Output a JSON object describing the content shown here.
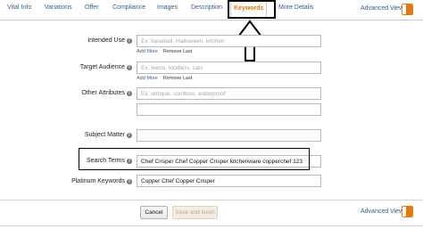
{
  "tabs": [
    {
      "label": "Vital Info"
    },
    {
      "label": "Variations"
    },
    {
      "label": "Offer"
    },
    {
      "label": "Compliance"
    },
    {
      "label": "Images"
    },
    {
      "label": "Description"
    },
    {
      "label": "Keywords",
      "active": true
    },
    {
      "label": "More Details"
    }
  ],
  "advanced_view": {
    "label": "Advanced View",
    "enabled": true
  },
  "accent_color": "#e47911",
  "link_color": "#3a5a8a",
  "form": {
    "intended_use": {
      "label": "Intended Use",
      "placeholder": "Ex: baseball, Halloween, kitchen",
      "add_more": "Add More",
      "remove_last": "Remove Last"
    },
    "target_audience": {
      "label": "Target Audience",
      "placeholder": "Ex: teens, toddlers, cats",
      "add_more": "Add More",
      "remove_last": "Remove Last"
    },
    "other_attributes": {
      "label": "Other Attributes",
      "placeholder": "Ex: antique, cordless, waterproof",
      "value2": ""
    },
    "subject_matter": {
      "label": "Subject Matter",
      "value": ""
    },
    "search_terms": {
      "label": "Search Terms",
      "value": "Chef Crisper Chef Copper Crisper kitchenware copperchef 123"
    },
    "platinum_keywords": {
      "label": "Platinum Keywords",
      "value": "Copper Chef Copper Crisper"
    }
  },
  "footer": {
    "cancel_label": "Cancel",
    "save_label": "Save and finish"
  },
  "icons": {
    "info": "info-icon",
    "toggle": "toggle-switch"
  }
}
